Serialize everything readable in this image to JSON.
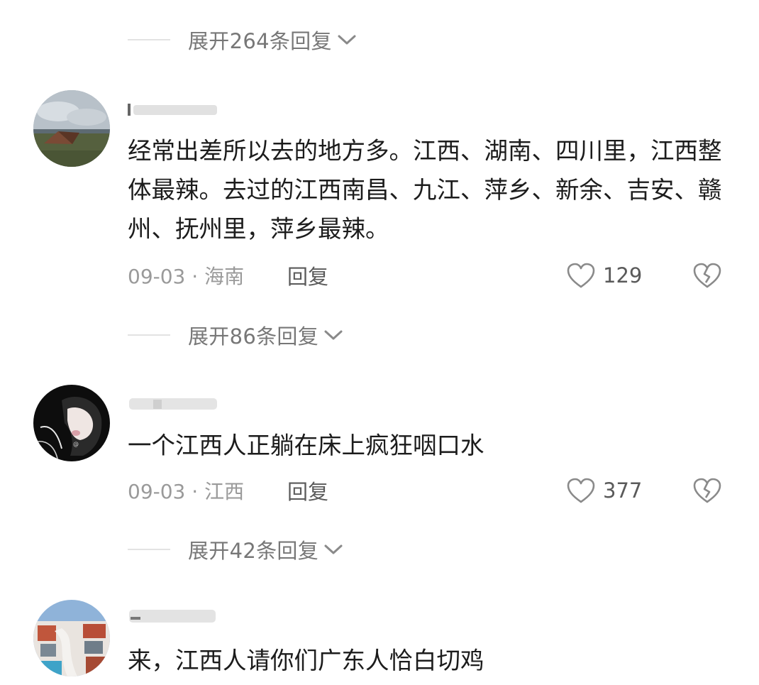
{
  "expand_replies": [
    {
      "label": "展开264条回复"
    },
    {
      "label": "展开86条回复"
    },
    {
      "label": "展开42条回复"
    }
  ],
  "comments": [
    {
      "content": "经常出差所以去的地方多。江西、湖南、四川里，江西整体最辣。去过的江西南昌、九江、萍乡、新余、吉安、赣州、抚州里，萍乡最辣。",
      "meta": "09-03 · 海南",
      "reply_label": "回复",
      "likes": "129",
      "avatar_icon": "landscape-tent-photo"
    },
    {
      "content": "一个江西人正躺在床上疯狂咽口水",
      "meta": "09-03 · 江西",
      "reply_label": "回复",
      "likes": "377",
      "avatar_icon": "illustrated-girl-portrait"
    },
    {
      "content": "来，江西人请你们广东人恰白切鸡",
      "avatar_icon": "resort-buildings-photo"
    }
  ],
  "colors": {
    "expand_text": "#777777",
    "meta_text": "#9a9a9a",
    "content_text": "#1c1c1c",
    "action_icon": "#8a8a8a"
  }
}
